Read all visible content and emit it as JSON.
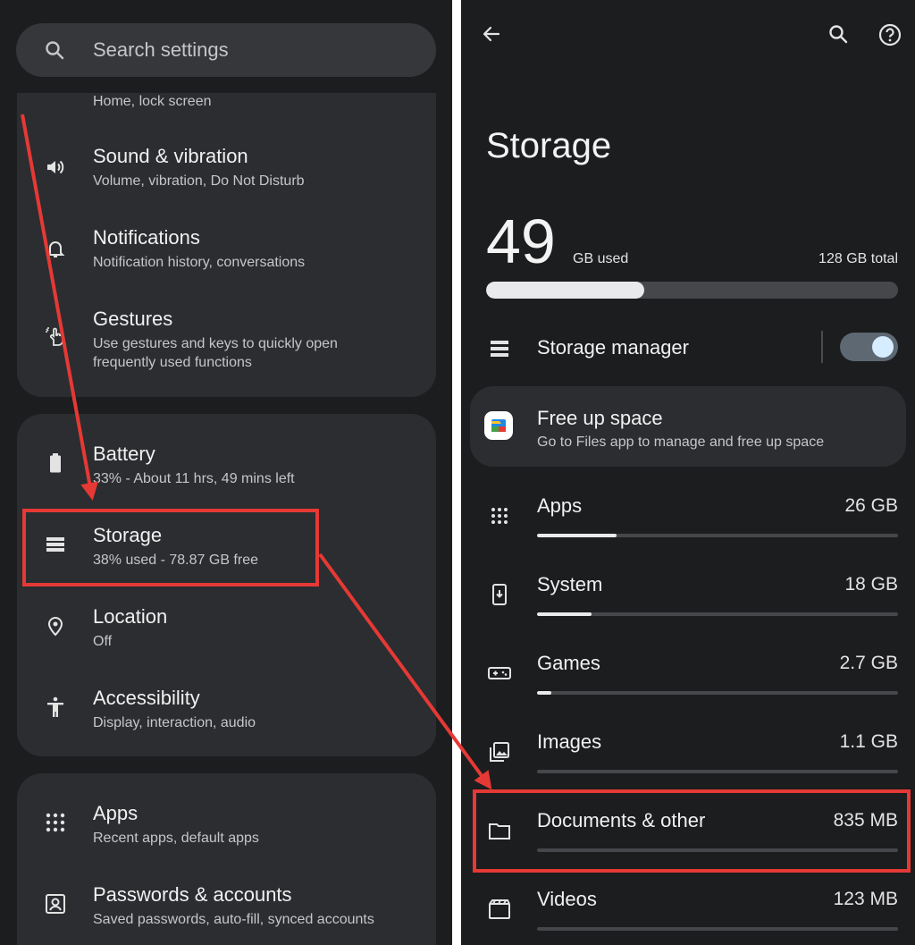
{
  "left": {
    "search_placeholder": "Search settings",
    "partial_sub": "Home, lock screen",
    "items1": [
      {
        "title": "Sound & vibration",
        "subtitle": "Volume, vibration, Do Not Disturb"
      },
      {
        "title": "Notifications",
        "subtitle": "Notification history, conversations"
      },
      {
        "title": "Gestures",
        "subtitle": "Use gestures and keys to quickly open",
        "subtitle2": "frequently used functions"
      }
    ],
    "items2": [
      {
        "title": "Battery",
        "subtitle": "33% - About 11 hrs, 49 mins left"
      },
      {
        "title": "Storage",
        "subtitle": "38% used - 78.87 GB free"
      },
      {
        "title": "Location",
        "subtitle": "Off"
      },
      {
        "title": "Accessibility",
        "subtitle": "Display, interaction, audio"
      }
    ],
    "items3": [
      {
        "title": "Apps",
        "subtitle": "Recent apps, default apps"
      },
      {
        "title": "Passwords & accounts",
        "subtitle": "Saved passwords, auto-fill, synced accounts"
      }
    ]
  },
  "right": {
    "title": "Storage",
    "used_value": "49",
    "used_unit": "GB used",
    "total": "128 GB total",
    "used_fraction": 0.383,
    "manager_label": "Storage manager",
    "manager_enabled": true,
    "freeup_title": "Free up space",
    "freeup_sub": "Go to Files app to manage and free up space",
    "categories": [
      {
        "name": "Apps",
        "size": "26 GB",
        "fraction": 0.22
      },
      {
        "name": "System",
        "size": "18 GB",
        "fraction": 0.15
      },
      {
        "name": "Games",
        "size": "2.7 GB",
        "fraction": 0.04
      },
      {
        "name": "Images",
        "size": "1.1 GB",
        "fraction": 0.0
      },
      {
        "name": "Documents & other",
        "size": "835 MB",
        "fraction": 0.0
      },
      {
        "name": "Videos",
        "size": "123 MB",
        "fraction": 0.0
      }
    ]
  },
  "colors": {
    "background": "#1c1d1f",
    "card": "#2b2d30",
    "accent_track": "#e9eaec",
    "toggle_thumb": "#d6ecff",
    "toggle_track": "#5e6873",
    "annotation": "#e53935"
  }
}
